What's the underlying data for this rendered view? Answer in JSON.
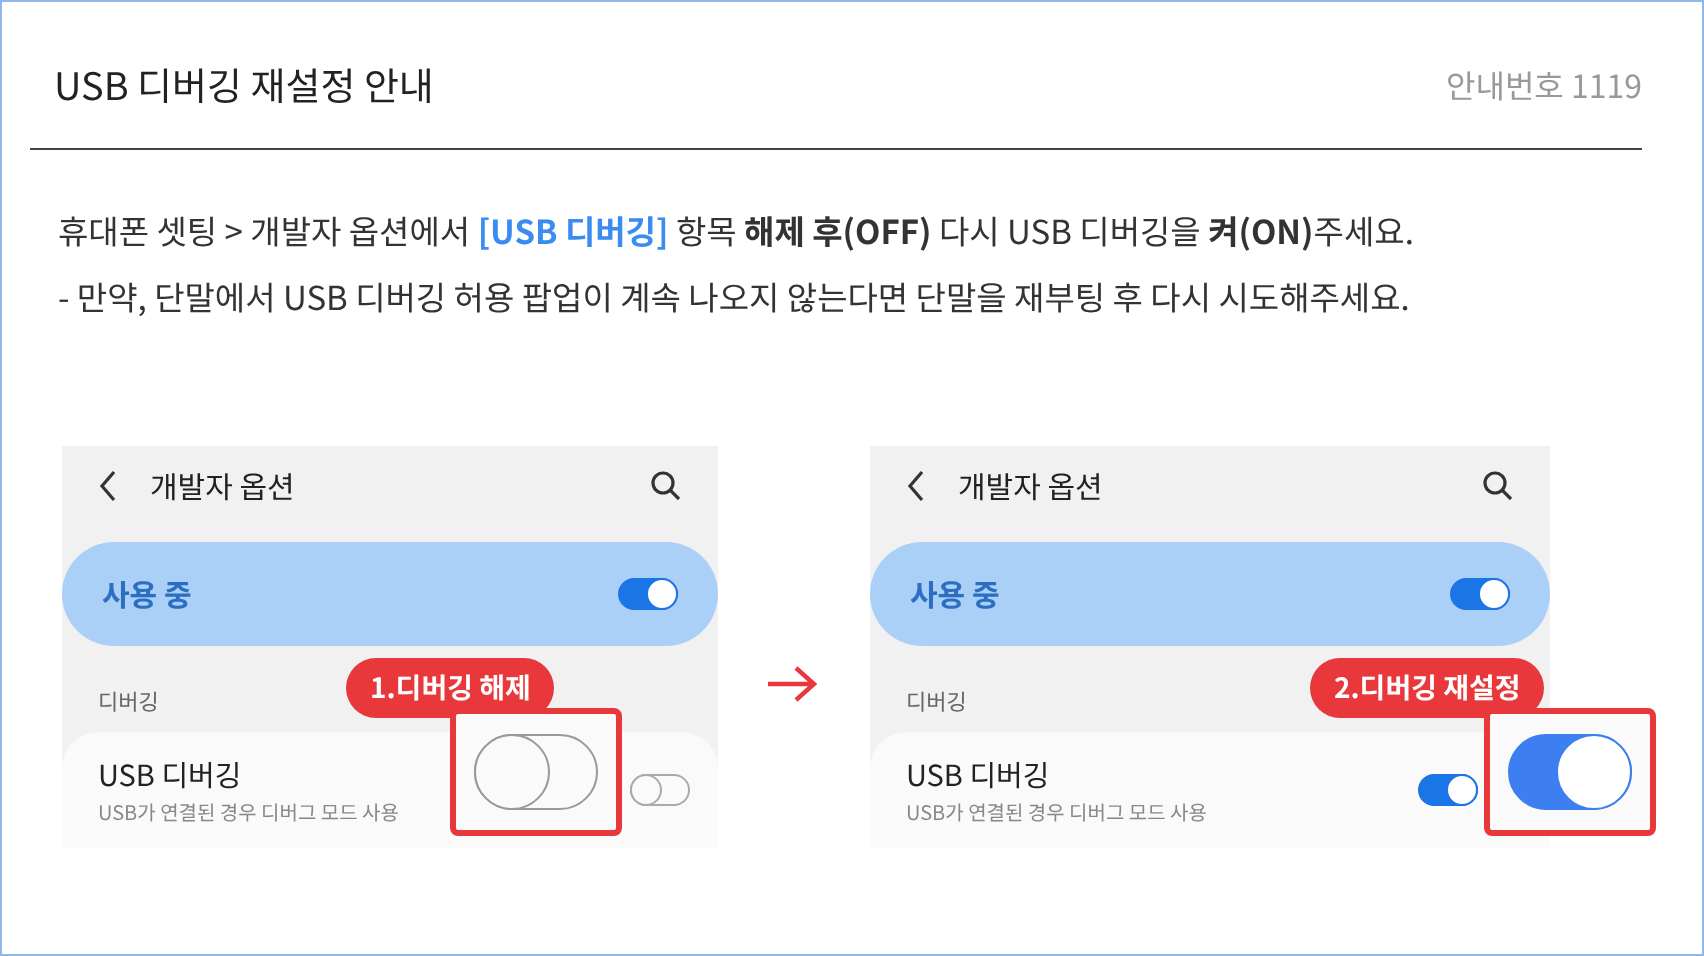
{
  "title": "USB 디버깅 재설정 안내",
  "notice_number": "안내번호 1119",
  "instructions": [
    {
      "segments": [
        {
          "kind": "plain",
          "text": "휴대폰 셋팅 > 개발자 옵션에서 "
        },
        {
          "kind": "highlight",
          "text": "[USB 디버깅]"
        },
        {
          "kind": "plain",
          "text": " 항목 "
        },
        {
          "kind": "bold",
          "text": "해제 후(OFF)"
        },
        {
          "kind": "plain",
          "text": " 다시 USB 디버깅을 "
        },
        {
          "kind": "bold",
          "text": "켜(ON)"
        },
        {
          "kind": "plain",
          "text": "주세요."
        }
      ]
    },
    {
      "segments": [
        {
          "kind": "plain",
          "text": "- 만약, 단말에서 USB 디버깅 허용 팝업이 계속 나오지 않는다면 단말을 재부팅 후 다시 시도해주세요."
        }
      ]
    }
  ],
  "screens": [
    {
      "header": "개발자 옵션",
      "master": {
        "label": "사용 중",
        "on": true
      },
      "section": "디버깅",
      "item": {
        "title": "USB 디버깅",
        "subtitle": "USB가 연결된 경우 디버그 모드 사용",
        "on": false
      },
      "callout": "1.디버깅 해제"
    },
    {
      "header": "개발자 옵션",
      "master": {
        "label": "사용 중",
        "on": true
      },
      "section": "디버깅",
      "item": {
        "title": "USB 디버깅",
        "subtitle": "USB가 연결된 경우 디버그 모드 사용",
        "on": true
      },
      "callout": "2.디버깅 재설정"
    }
  ]
}
